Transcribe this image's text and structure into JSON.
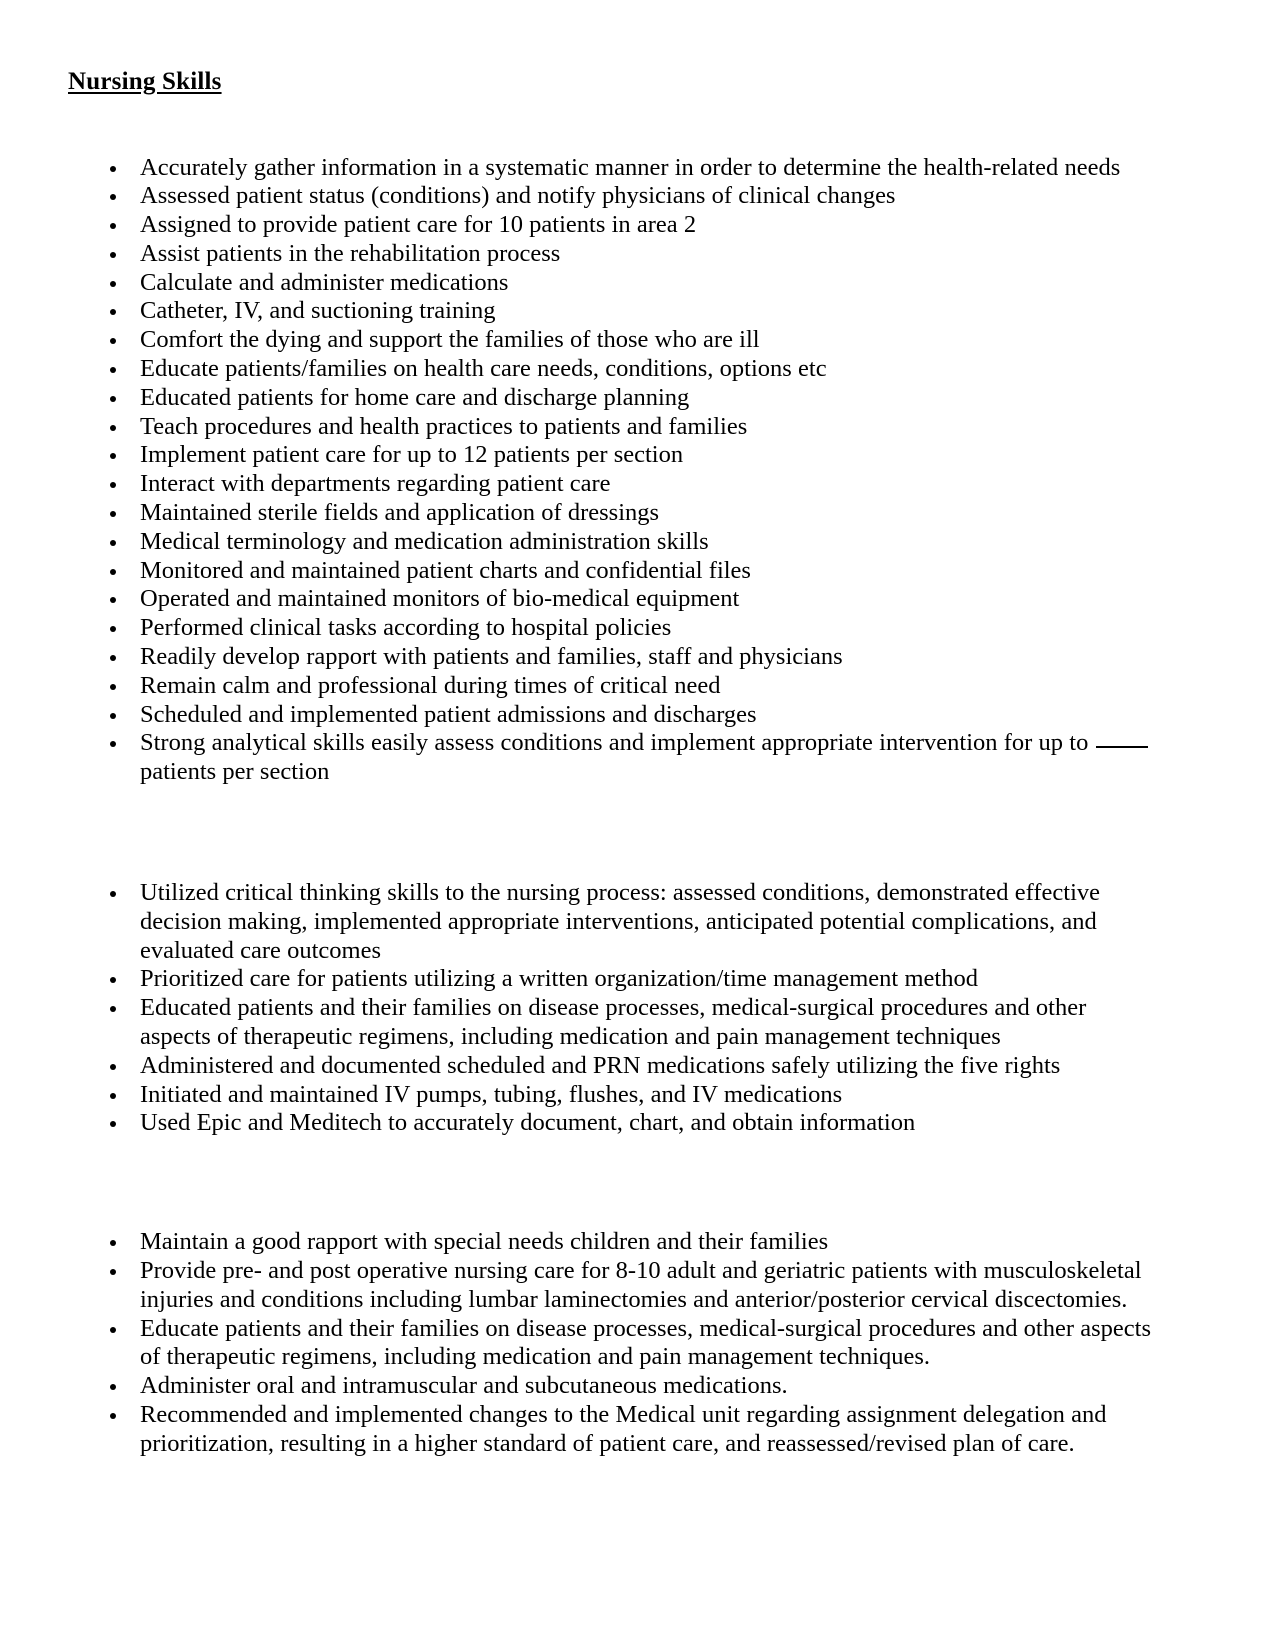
{
  "document": {
    "title": "Nursing Skills",
    "sections": [
      {
        "id": "core-nursing-skills",
        "items": [
          "Accurately gather information in a systematic manner in order to determine the health-related needs",
          "Assessed patient status (conditions) and notify physicians of clinical changes",
          "Assigned to provide patient care for 10 patients in area 2",
          "Assist patients in the rehabilitation process",
          "Calculate and administer medications",
          "Catheter, IV, and suctioning training",
          "Comfort the dying and support the families of those who are ill",
          "Educate patients/families on health care needs, conditions, options etc",
          "Educated patients for home care and discharge planning",
          "Teach procedures and health practices to patients and families",
          "Implement patient care for up to 12 patients per section",
          "Interact with departments regarding patient care",
          "Maintained sterile fields and application of dressings",
          "Medical terminology and medication administration skills",
          "Monitored and maintained patient charts and confidential files",
          "Operated and maintained monitors of bio-medical equipment",
          "Performed clinical tasks according to hospital policies",
          "Readily develop rapport with patients and families, staff and physicians",
          "Remain calm and professional during times of critical need",
          "Scheduled and implemented patient admissions and discharges"
        ],
        "last_item": {
          "before_blank": "Strong analytical skills easily assess conditions and implement appropriate intervention for up to",
          "blank": "____",
          "after_blank": "patients per section"
        }
      },
      {
        "id": "clinical-practice",
        "items": [
          "Utilized critical thinking skills to the nursing process: assessed conditions, demonstrated effective decision making, implemented appropriate interventions, anticipated potential complications, and evaluated care outcomes",
          "Prioritized care for patients utilizing a written organization/time management method",
          "Educated patients and their families on disease processes, medical-surgical procedures and other aspects of therapeutic regimens, including medication and pain management techniques",
          "Administered and documented scheduled and PRN medications safely utilizing the five rights",
          "Initiated and maintained IV pumps, tubing, flushes, and IV medications",
          "Used Epic and Meditech to accurately document, chart, and obtain information"
        ]
      },
      {
        "id": "patient-care-duties",
        "items": [
          "Maintain a good rapport with special needs children and their families",
          "Provide pre- and post operative nursing care for 8-10 adult and geriatric patients with musculoskeletal injuries and conditions including lumbar laminectomies and anterior/posterior cervical discectomies.",
          "Educate patients and their families on disease processes, medical-surgical procedures and other aspects of therapeutic regimens, including medication and pain management techniques.",
          "Administer oral and intramuscular and subcutaneous medications.",
          "Recommended and implemented changes to the Medical unit regarding assignment delegation and prioritization, resulting in a higher standard of patient care, and reassessed/revised plan of care."
        ]
      }
    ]
  },
  "colors": {
    "page_background": "#ffffff",
    "text": "#000000"
  }
}
